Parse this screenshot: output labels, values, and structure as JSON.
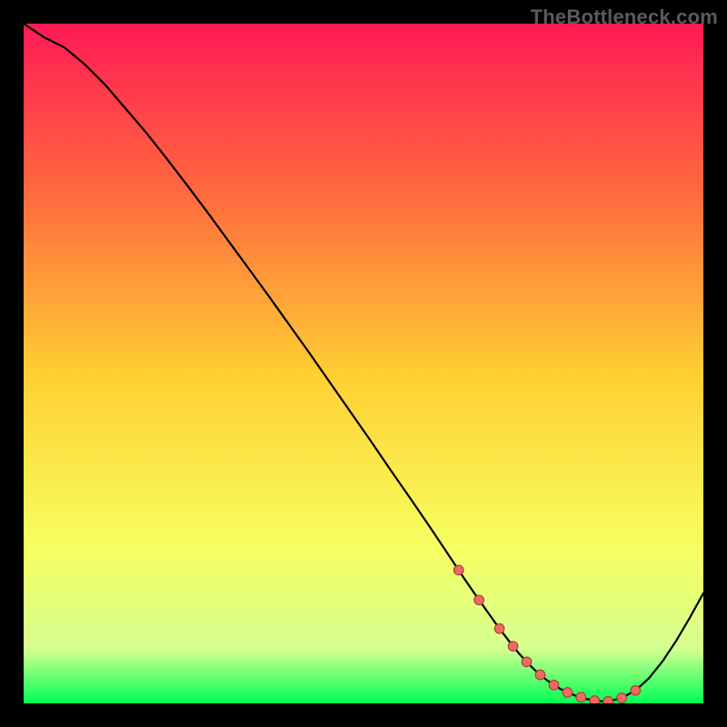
{
  "watermark": "TheBottleneck.com",
  "colors": {
    "background": "#000000",
    "gradient_top": "#ff1a55",
    "gradient_upper_mid": "#ff6a3e",
    "gradient_mid": "#ffd033",
    "gradient_lower_mid": "#f6ff60",
    "gradient_low": "#d4ff90",
    "gradient_bottom": "#00ff55",
    "curve": "#000000",
    "dot_fill": "#ee6b63",
    "dot_stroke": "#a63b35"
  },
  "chart_data": {
    "type": "line",
    "title": "",
    "xlabel": "",
    "ylabel": "",
    "xlim": [
      0,
      100
    ],
    "ylim": [
      0,
      100
    ],
    "series": [
      {
        "name": "curve",
        "x": [
          0,
          3,
          6,
          9,
          12,
          15,
          18,
          21,
          24,
          27,
          30,
          33,
          36,
          39,
          42,
          45,
          48,
          51,
          54,
          57,
          60,
          62,
          64,
          65,
          67,
          68,
          70,
          72,
          73,
          74,
          75,
          76,
          77,
          79,
          81,
          83,
          85,
          86,
          88,
          90,
          92,
          94,
          96,
          98,
          100
        ],
        "values": [
          100,
          98,
          96.5,
          94,
          91,
          87.5,
          84,
          80.2,
          76.3,
          72.3,
          68.2,
          64.1,
          60,
          55.8,
          51.6,
          47.3,
          43,
          38.7,
          34.3,
          30,
          25.6,
          22.6,
          19.6,
          18.1,
          15.2,
          13.8,
          11,
          8.4,
          7.2,
          6.1,
          5.1,
          4.2,
          3.4,
          2.1,
          1.2,
          0.6,
          0.3,
          0.3,
          0.8,
          1.9,
          3.7,
          6.2,
          9.2,
          12.6,
          16.2
        ]
      }
    ],
    "dots": {
      "name": "highlight-dots",
      "x": [
        64,
        67,
        70,
        72,
        74,
        76,
        78,
        80,
        82,
        84,
        86,
        88,
        90
      ],
      "values": [
        19.6,
        15.2,
        11.0,
        8.4,
        6.1,
        4.2,
        2.7,
        1.6,
        0.9,
        0.4,
        0.3,
        0.8,
        1.9
      ]
    }
  }
}
